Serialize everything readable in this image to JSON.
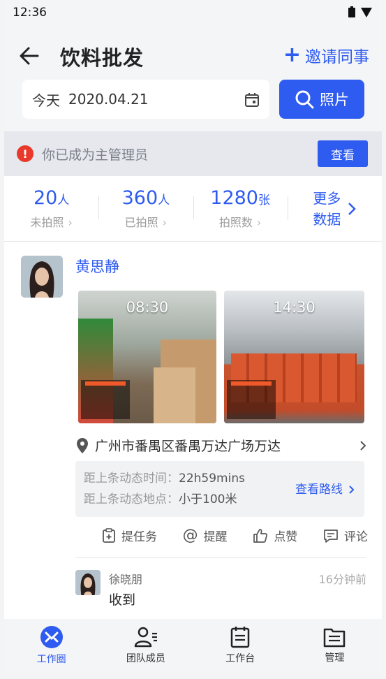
{
  "status_bar": {
    "time": "12:36"
  },
  "header": {
    "title": "饮料批发",
    "invite_label": "邀请同事",
    "date_prefix": "今天",
    "date_value": "2020.04.21",
    "photo_button": "照片"
  },
  "notice": {
    "text": "你已成为主管理员",
    "button": "查看"
  },
  "stats": [
    {
      "value": "20",
      "unit": "人",
      "label": "未拍照"
    },
    {
      "value": "360",
      "unit": "人",
      "label": "已拍照"
    },
    {
      "value": "1280",
      "unit": "张",
      "label": "拍照数"
    }
  ],
  "more_data": {
    "line1": "更多",
    "line2": "数据"
  },
  "post": {
    "author": "黄思静",
    "photos": [
      {
        "time": "08:30"
      },
      {
        "time": "14:30"
      }
    ],
    "location": "广州市番禺区番禺万达广场万达",
    "time_label": "距上条动态时间：",
    "time_value": "22h59mins",
    "place_label": "距上条动态地点：",
    "place_value": "小于100米",
    "route_link": "查看路线"
  },
  "actions": [
    {
      "label": "提任务",
      "icon": "task-icon"
    },
    {
      "label": "提醒",
      "icon": "at-icon"
    },
    {
      "label": "点赞",
      "icon": "like-icon"
    },
    {
      "label": "评论",
      "icon": "comment-icon"
    }
  ],
  "comment": {
    "name": "徐晓朋",
    "time": "16分钟前",
    "text": "收到"
  },
  "tabbar": [
    {
      "label": "工作圈",
      "icon": "workcircle-icon",
      "active": true
    },
    {
      "label": "团队成员",
      "icon": "team-icon",
      "active": false
    },
    {
      "label": "工作台",
      "icon": "workbench-icon",
      "active": false
    },
    {
      "label": "管理",
      "icon": "manage-icon",
      "active": false
    }
  ],
  "colors": {
    "accent": "#2e5bf0",
    "warning": "#e8392b"
  }
}
